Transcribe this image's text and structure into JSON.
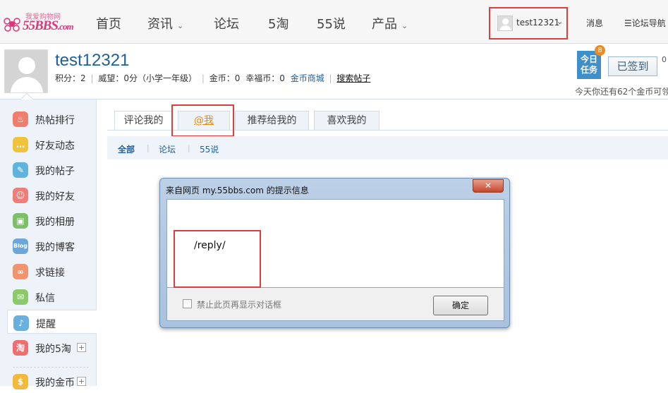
{
  "logo": {
    "slogan": "我爱购物网",
    "brand": "55BBS",
    "suffix": ".com"
  },
  "nav": {
    "items": [
      {
        "label": "首页",
        "caret": false
      },
      {
        "label": "资讯",
        "caret": true
      },
      {
        "label": "论坛",
        "caret": false
      },
      {
        "label": "5淘",
        "caret": false
      },
      {
        "label": "55说",
        "caret": false
      },
      {
        "label": "产品",
        "caret": true
      }
    ],
    "username": "test12321",
    "messages": "消息",
    "forum_nav": "论坛导航"
  },
  "profile": {
    "name": "test12321",
    "points_label": "积分：",
    "points": "2",
    "prestige_label": "威望：",
    "prestige": "0分（小学一年级）",
    "gold_label": "金币：",
    "gold": "0",
    "happy_label": "幸福币：",
    "happy": "0",
    "mall_link": "金币商城",
    "search_posts": "搜索帖子"
  },
  "task": {
    "badge_text": "今日任务",
    "count": "8",
    "signed_label": "已签到",
    "side_value": "0",
    "tip": "今天你还有62个金币可领"
  },
  "sidebar": {
    "items": [
      {
        "label": "热帖排行",
        "icon": "fire-icon",
        "glyph": "♨",
        "color": "#f07d6e",
        "plus": false,
        "active": false
      },
      {
        "label": "好友动态",
        "icon": "chat-icon",
        "glyph": "…",
        "color": "#f1c23b",
        "plus": false,
        "active": false
      },
      {
        "label": "我的帖子",
        "icon": "edit-icon",
        "glyph": "✎",
        "color": "#5fb3dd",
        "plus": false,
        "active": false
      },
      {
        "label": "我的好友",
        "icon": "friends-icon",
        "glyph": "☺",
        "color": "#ef7d78",
        "plus": false,
        "active": false
      },
      {
        "label": "我的相册",
        "icon": "photo-icon",
        "glyph": "▣",
        "color": "#7fbf6a",
        "plus": false,
        "active": false
      },
      {
        "label": "我的博客",
        "icon": "blog-icon",
        "glyph": "Blog",
        "color": "#6ba7d8",
        "plus": false,
        "active": false
      },
      {
        "label": "求链接",
        "icon": "link-icon",
        "glyph": "∞",
        "color": "#f1946e",
        "plus": false,
        "active": false
      },
      {
        "label": "私信",
        "icon": "mail-icon",
        "glyph": "✉",
        "color": "#8dc86d",
        "plus": false,
        "active": false
      },
      {
        "label": "提醒",
        "icon": "bell-icon",
        "glyph": "♪",
        "color": "#6ab0de",
        "plus": false,
        "active": true
      },
      {
        "label": "我的5淘",
        "icon": "tao-icon",
        "glyph": "淘",
        "color": "#ef6f6f",
        "plus": true,
        "active": false
      },
      {
        "label": "我的金币",
        "icon": "coin-icon",
        "glyph": "$",
        "color": "#f3b93a",
        "plus": true,
        "active": false
      }
    ]
  },
  "tabs": [
    {
      "label": "评论我的",
      "active": true
    },
    {
      "label": "@我",
      "active": false
    },
    {
      "label": "推荐给我的",
      "active": false
    },
    {
      "label": "喜欢我的",
      "active": false
    }
  ],
  "subnav": {
    "all": "全部",
    "forum": "论坛",
    "shuo": "55说"
  },
  "dialog": {
    "title": "来自网页 my.55bbs.com 的提示信息",
    "close": "✕",
    "message": "/reply/",
    "checkbox_label": "禁止此页再显示对话框",
    "ok": "确定"
  }
}
